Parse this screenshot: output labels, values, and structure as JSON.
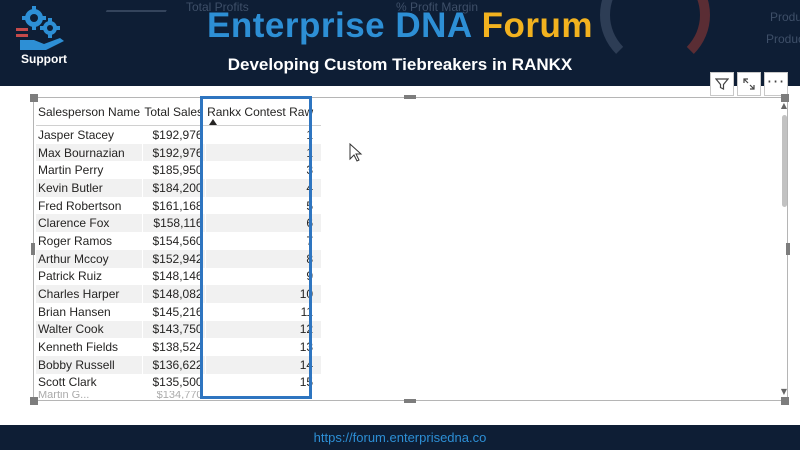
{
  "header": {
    "brand_main": "Enterprise DNA",
    "brand_accent": "Forum",
    "subtitle": "Developing Custom Tiebreakers in RANKX",
    "logo_label": "Support",
    "background_labels": [
      "Total Profits",
      "% Profit Margin",
      "Produ",
      "Produc"
    ]
  },
  "visual_actions": {
    "filter_icon": "filter-icon",
    "focus_icon": "focus-mode-icon",
    "more_label": "···"
  },
  "table": {
    "columns": [
      "Salesperson Name",
      "Total Sales",
      "Rankx Contest Raw"
    ],
    "sorted_column": "Rankx Contest Raw",
    "rows": [
      [
        "Jasper Stacey",
        "$192,976",
        "1"
      ],
      [
        "Max Bournazian",
        "$192,976",
        "1"
      ],
      [
        "Martin Perry",
        "$185,950",
        "3"
      ],
      [
        "Kevin Butler",
        "$184,200",
        "4"
      ],
      [
        "Fred Robertson",
        "$161,168",
        "5"
      ],
      [
        "Clarence Fox",
        "$158,116",
        "6"
      ],
      [
        "Roger Ramos",
        "$154,560",
        "7"
      ],
      [
        "Arthur Mccoy",
        "$152,942",
        "8"
      ],
      [
        "Patrick Ruiz",
        "$148,146",
        "9"
      ],
      [
        "Charles Harper",
        "$148,082",
        "10"
      ],
      [
        "Brian Hansen",
        "$145,216",
        "11"
      ],
      [
        "Walter Cook",
        "$143,750",
        "12"
      ],
      [
        "Kenneth Fields",
        "$138,524",
        "13"
      ],
      [
        "Bobby Russell",
        "$136,622",
        "14"
      ],
      [
        "Scott Clark",
        "$135,500",
        "15"
      ]
    ],
    "partial_row": [
      "Martin G...",
      "$134,770",
      ""
    ]
  },
  "footer": {
    "url": "https://forum.enterprisedna.co"
  },
  "colors": {
    "banner_bg": "#0e1e35",
    "brand_blue": "#2d8fd5",
    "brand_gold": "#f2b21f",
    "highlight": "#2e75c0"
  }
}
